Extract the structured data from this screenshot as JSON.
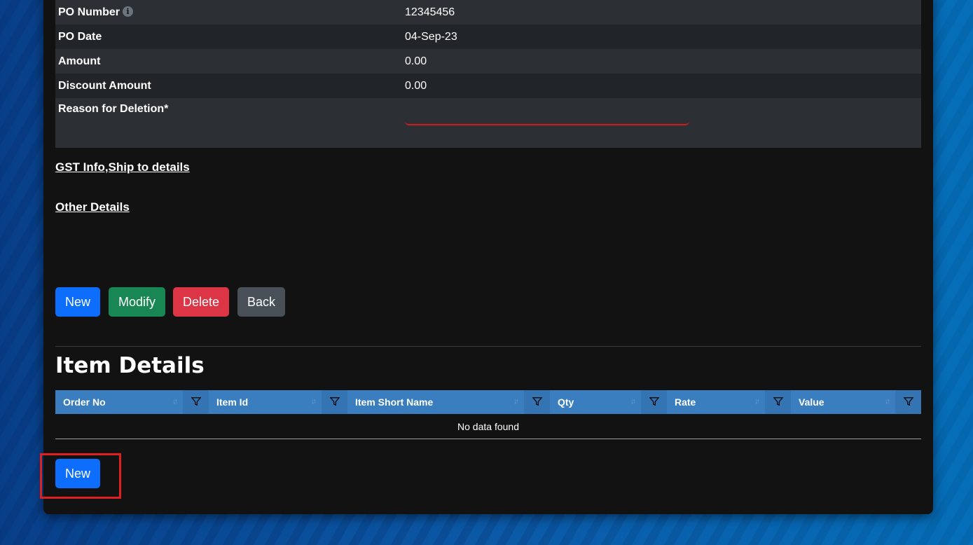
{
  "fields": [
    {
      "label": "PO Number",
      "value": "12345456",
      "info": "i"
    },
    {
      "label": "PO Date",
      "value": "04-Sep-23"
    },
    {
      "label": "Amount",
      "value": "0.00"
    },
    {
      "label": "Discount Amount",
      "value": "0.00"
    },
    {
      "label": "Reason for Deletion*",
      "value": ""
    }
  ],
  "links": {
    "gst": "GST Info,Ship to details",
    "other": "Other Details"
  },
  "actions": {
    "new": "New",
    "modify": "Modify",
    "delete": "Delete",
    "back": "Back"
  },
  "item_details": {
    "title": "Item Details",
    "columns": [
      "Order No",
      "Item Id",
      "Item Short Name",
      "Qty",
      "Rate",
      "Value"
    ],
    "empty_text": "No data found",
    "new_button": "New"
  },
  "colors": {
    "primary": "#0d6efd",
    "success": "#198754",
    "danger": "#dc3545",
    "secondary": "#495057",
    "header": "#3a7ebf",
    "highlight": "#e02020"
  },
  "icons": {
    "info": "info-icon",
    "sort": "sort-icon",
    "filter": "filter-icon"
  }
}
